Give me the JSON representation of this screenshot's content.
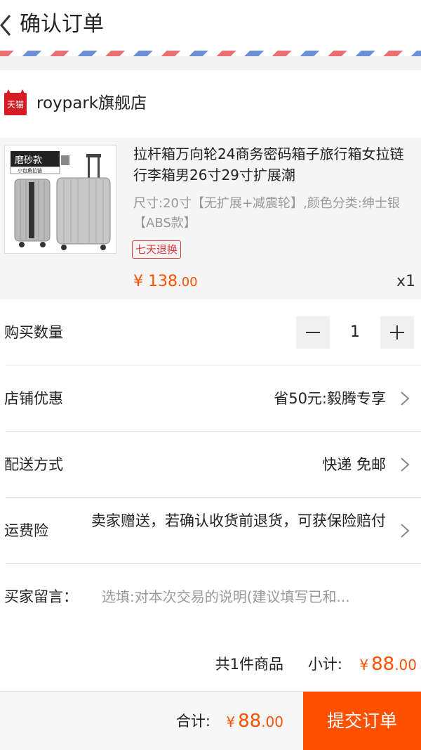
{
  "header": {
    "title": "确认订单"
  },
  "shop": {
    "badge_text": "天猫",
    "name": "roypark旗舰店"
  },
  "product": {
    "title": "拉杆箱万向轮24商务密码箱子旅行箱女拉链行李箱男26寸29寸扩展潮",
    "spec": "尺寸:20寸【无扩展+减震轮】,颜色分类:绅士银【ABS款】",
    "badge": "七天退换",
    "image_labels": {
      "main": "磨砂款",
      "sub": "小包角拉链"
    },
    "price_symbol": "¥",
    "price_int": "138",
    "price_dec": ".00",
    "quantity": "x1"
  },
  "rows": {
    "quantity": {
      "label": "购买数量",
      "value": "1"
    },
    "discount": {
      "label": "店铺优惠",
      "value": "省50元:毅腾专享"
    },
    "shipping": {
      "label": "配送方式",
      "value": "快递 免邮"
    },
    "insurance": {
      "label": "运费险",
      "value": "卖家赠送，若确认收货前退货，可获保险赔付"
    },
    "message": {
      "label": "买家留言：",
      "placeholder": "选填:对本次交易的说明(建议填写已和..."
    }
  },
  "subtotal": {
    "count": "共1件商品",
    "label": "小计:",
    "symbol": "¥",
    "int": "88",
    "dec": ".00"
  },
  "footer": {
    "label": "合计:",
    "symbol": "¥",
    "int": "88",
    "dec": ".00",
    "submit": "提交订单"
  },
  "colors": {
    "accent": "#ff5000",
    "badge": "#e4393c",
    "tmall": "#d51c24"
  }
}
